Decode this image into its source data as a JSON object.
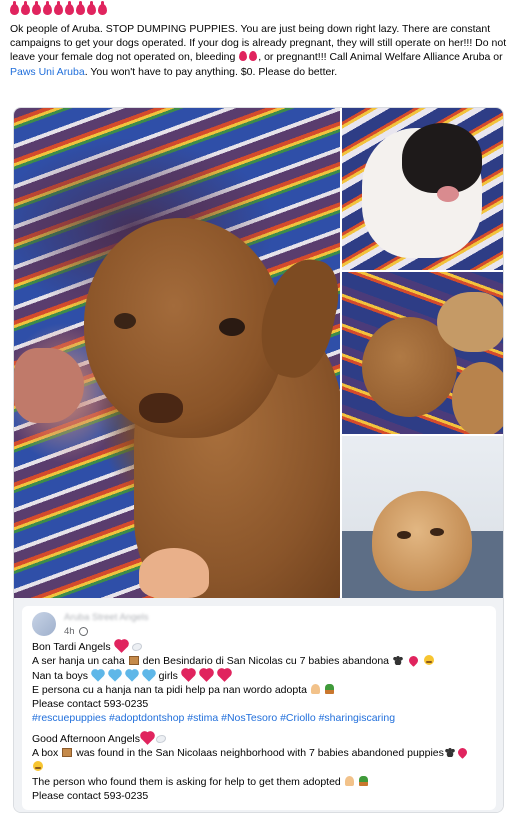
{
  "post": {
    "top_emoji_count": 9,
    "top_emoji_name": "drop-of-blood",
    "text_part1": "Ok people of Aruba. STOP DUMPING PUPPIES. You are just being down right lazy. There are constant campaigns to get your dogs operated. If your dog is already pregnant, they will still operate on her!!! Do not leave your female dog not operated on, bleeding ",
    "text_part2": ", or pregnant!!! Call Animal Welfare Alliance Aruba or ",
    "link_text": "Paws Uni Aruba",
    "text_part3": ". You won't have to pay anything. $0. Please do better."
  },
  "photos": [
    {
      "name": "puppy-photo-main",
      "alt": "Brown puppy on striped blanket"
    },
    {
      "name": "puppy-photo-black-white",
      "alt": "Black and white puppy"
    },
    {
      "name": "puppy-photo-sleeping",
      "alt": "Puppies sleeping on blanket"
    },
    {
      "name": "puppy-photo-in-box",
      "alt": "Tan puppy in box"
    }
  ],
  "shared_post": {
    "author": "Aruba Street Angels",
    "time": "4h",
    "lines": [
      {
        "text": "Bon Tardi Angels",
        "emojis_after": [
          "heart-red",
          "angel-wing"
        ]
      },
      {
        "text": "A ser hanja un caha ",
        "mid_emoji": "box-emoji",
        "text_after": " den Besindario di San Nicolas cu 7 babies abandona",
        "emojis_after": [
          "paw-emoji",
          "broken-heart",
          "crying-face"
        ]
      },
      {
        "text": "Nan ta boys ",
        "mid_emojis": [
          "heart-blue",
          "heart-blue",
          "heart-blue",
          "heart-blue"
        ],
        "text_after": " girls",
        "emojis_after": [
          "heart-red",
          "heart-red",
          "heart-red"
        ]
      },
      {
        "text": "E persona cu a hanja nan ta pidi help pa nan wordo adopta",
        "emojis_after": [
          "pray-hands",
          "cactus-pot"
        ]
      },
      {
        "text": "Please contact 593-0235"
      }
    ],
    "hashtags": "#rescuepuppies #adoptdontshop #stima #NosTesoro #Criollo #sharingiscaring",
    "lines_en": [
      {
        "text": "Good Afternoon Angels",
        "emojis_after": [
          "heart-red",
          "angel-wing"
        ]
      },
      {
        "text": "A box ",
        "mid_emoji": "box-emoji",
        "text_after": " was found in the San Nicolaas neighborhood with 7 babies abandoned puppies",
        "emojis_after": [
          "paw-emoji",
          "broken-heart"
        ]
      },
      {
        "text": "",
        "emojis_after": [
          "crying-face"
        ]
      },
      {
        "text": "The person who found them is asking for help to get them adopted",
        "emojis_after": [
          "pray-hands",
          "cactus-pot"
        ]
      },
      {
        "text": "Please contact 593-0235"
      }
    ]
  }
}
